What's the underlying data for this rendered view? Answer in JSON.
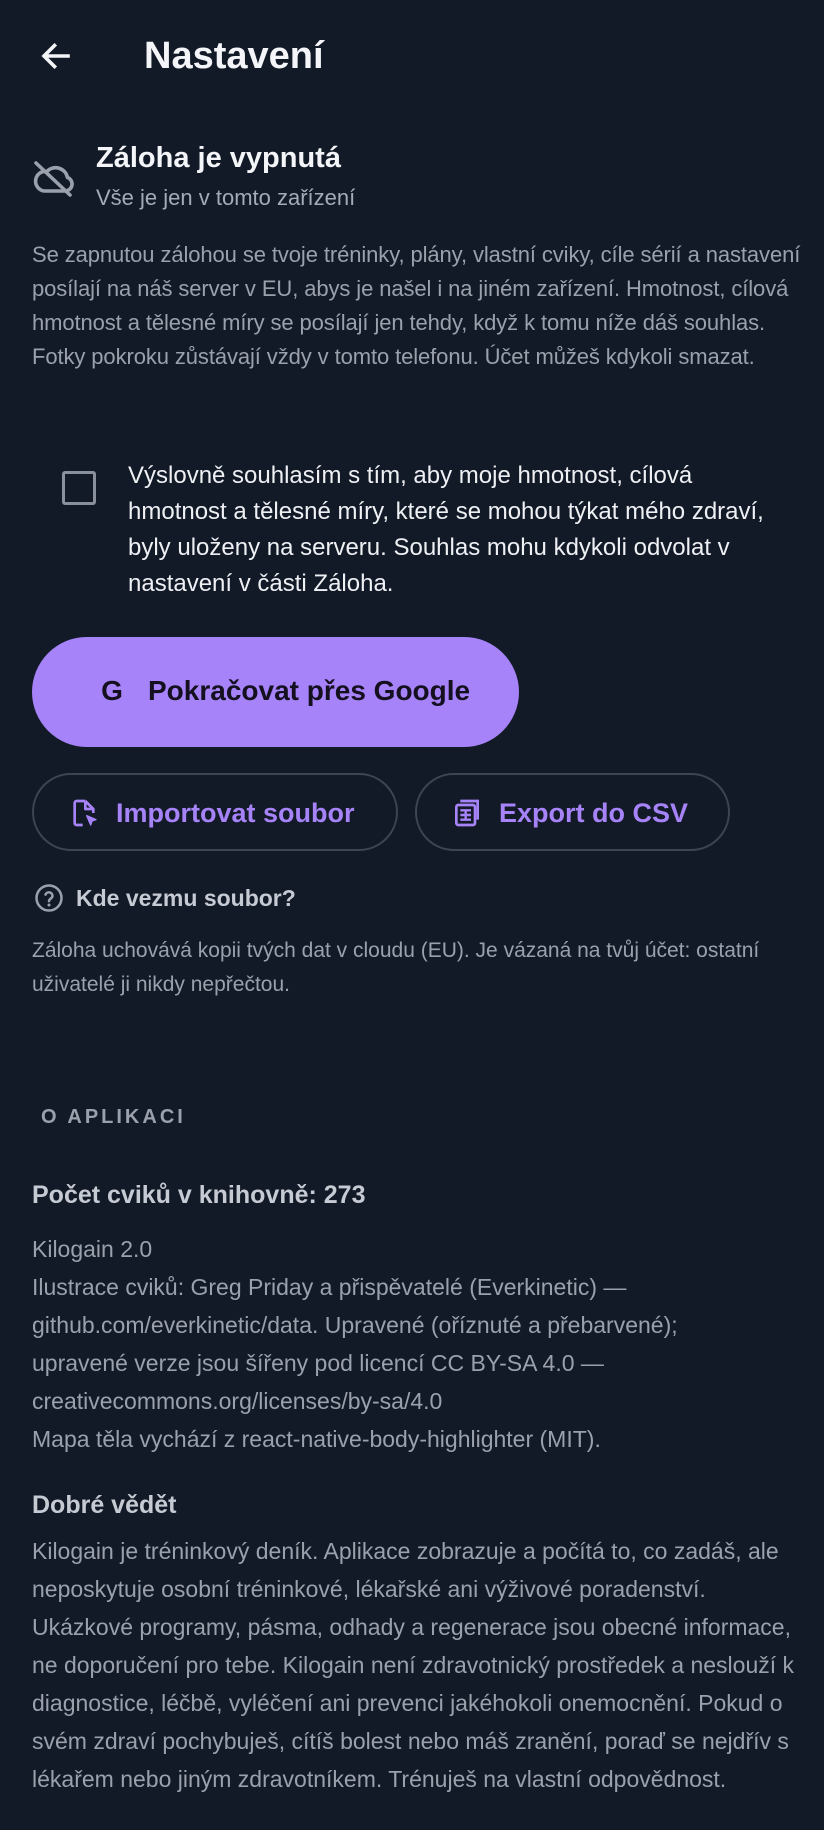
{
  "header": {
    "title": "Nastavení",
    "back_icon": "arrow-left-icon"
  },
  "backup": {
    "icon": "cloud-off-icon",
    "title": "Záloha je vypnutá",
    "subtitle": "Vše je jen v tomto zařízení",
    "description": "Se zapnutou zálohou se tvoje tréninky, plány, vlastní cviky, cíle sérií a nastavení posílají na náš server v EU, abys je našel i na jiném zařízení. Hmotnost, cílová hmotnost a tělesné míry se posílají jen tehdy, když k tomu níže dáš souhlas. Fotky pokroku zůstávají vždy v tomto telefonu. Účet můžeš kdykoli smazat.",
    "consent": {
      "checked": false,
      "text": "Výslovně souhlasím s tím, aby moje hmotnost, cílová hmotnost a tělesné míry, které se mohou týkat mého zdraví, byly uloženy na serveru. Souhlas mohu kdykoli odvolat v nastavení v části Záloha."
    },
    "google_button": {
      "icon": "google-g-icon",
      "icon_glyph": "G",
      "label": "Pokračovat přes Google"
    },
    "import_button": {
      "icon": "file-import-icon",
      "label": "Importovat soubor"
    },
    "export_button": {
      "icon": "spreadsheet-icon",
      "label": "Export do CSV"
    },
    "help": {
      "icon": "help-circle-icon",
      "label": "Kde vezmu soubor?"
    },
    "cloud_note": "Záloha uchovává kopii tvých dat v cloudu (EU). Je vázaná na tvůj účet: ostatní uživatelé ji nikdy nepřečtou."
  },
  "about": {
    "heading": "O APLIKACI",
    "exercise_count": "Počet cviků v knihovně: 273",
    "lines": [
      "Kilogain 2.0",
      "Ilustrace cviků: Greg Priday a přispěvatelé (Everkinetic) —",
      "github.com/everkinetic/data. Upravené (oříznuté a přebarvené);",
      "upravené verze jsou šířeny pod licencí CC BY-SA 4.0 —",
      "creativecommons.org/licenses/by-sa/4.0",
      "Mapa těla vychází z react-native-body-highlighter (MIT)."
    ],
    "good_to_know_title": "Dobré vědět",
    "good_to_know_text": "Kilogain je tréninkový deník. Aplikace zobrazuje a počítá to, co zadáš, ale neposkytuje osobní tréninkové, lékařské ani výživové poradenství. Ukázkové programy, pásma, odhady a regenerace jsou obecné informace, ne doporučení pro tebe. Kilogain není zdravotnický prostředek a neslouží k diagnostice, léčbě, vyléčení ani prevenci jakéhokoli onemocnění. Pokud o svém zdraví pochybuješ, cítíš bolest nebo máš zranění, poraď se nejdřív s lékařem nebo jiným zdravotníkem. Trénuješ na vlastní odpovědnost."
  },
  "colors": {
    "background": "#131a27",
    "accent": "#a683f8",
    "text_primary": "#f4f5f8",
    "text_secondary": "#9aa1ad"
  }
}
